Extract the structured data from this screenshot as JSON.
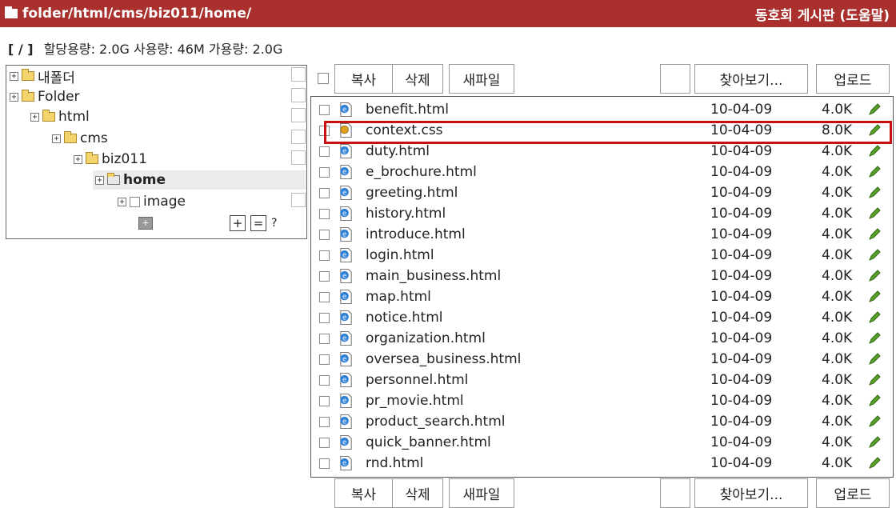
{
  "title": {
    "path": "folder/html/cms/biz011/home/",
    "right": "동호회 게시판 (도움말)"
  },
  "quota": {
    "root": "[ / ]",
    "text": "할당용량: 2.0G   사용량: 46M   가용량: 2.0G"
  },
  "tree": {
    "items": [
      {
        "label": "내폴더"
      },
      {
        "label": "Folder"
      },
      {
        "label": "html"
      },
      {
        "label": "cms"
      },
      {
        "label": "biz011"
      },
      {
        "label": "home"
      },
      {
        "label": "image"
      }
    ],
    "buttons": {
      "add": "+",
      "equal": "=",
      "help": "?"
    }
  },
  "toolbar": {
    "copy": "복사",
    "delete": "삭제",
    "newfile": "새파일",
    "browse": "찾아보기...",
    "upload": "업로드"
  },
  "files": [
    {
      "name": "benefit.html",
      "date": "10-04-09",
      "size": "4.0K",
      "type": "html-file-icon"
    },
    {
      "name": "context.css",
      "date": "10-04-09",
      "size": "8.0K",
      "type": "css-file-icon"
    },
    {
      "name": "duty.html",
      "date": "10-04-09",
      "size": "4.0K",
      "type": "html-file-icon"
    },
    {
      "name": "e_brochure.html",
      "date": "10-04-09",
      "size": "4.0K",
      "type": "html-file-icon"
    },
    {
      "name": "greeting.html",
      "date": "10-04-09",
      "size": "4.0K",
      "type": "html-file-icon"
    },
    {
      "name": "history.html",
      "date": "10-04-09",
      "size": "4.0K",
      "type": "html-file-icon"
    },
    {
      "name": "introduce.html",
      "date": "10-04-09",
      "size": "4.0K",
      "type": "html-file-icon"
    },
    {
      "name": "login.html",
      "date": "10-04-09",
      "size": "4.0K",
      "type": "html-file-icon"
    },
    {
      "name": "main_business.html",
      "date": "10-04-09",
      "size": "4.0K",
      "type": "html-file-icon"
    },
    {
      "name": "map.html",
      "date": "10-04-09",
      "size": "4.0K",
      "type": "html-file-icon"
    },
    {
      "name": "notice.html",
      "date": "10-04-09",
      "size": "4.0K",
      "type": "html-file-icon"
    },
    {
      "name": "organization.html",
      "date": "10-04-09",
      "size": "4.0K",
      "type": "html-file-icon"
    },
    {
      "name": "oversea_business.html",
      "date": "10-04-09",
      "size": "4.0K",
      "type": "html-file-icon"
    },
    {
      "name": "personnel.html",
      "date": "10-04-09",
      "size": "4.0K",
      "type": "html-file-icon"
    },
    {
      "name": "pr_movie.html",
      "date": "10-04-09",
      "size": "4.0K",
      "type": "html-file-icon"
    },
    {
      "name": "product_search.html",
      "date": "10-04-09",
      "size": "4.0K",
      "type": "html-file-icon"
    },
    {
      "name": "quick_banner.html",
      "date": "10-04-09",
      "size": "4.0K",
      "type": "html-file-icon"
    },
    {
      "name": "rnd.html",
      "date": "10-04-09",
      "size": "4.0K",
      "type": "html-file-icon"
    }
  ],
  "colors": {
    "titlebar": "#a9302c",
    "highlight": "#c81010",
    "edit": "#59a02a"
  }
}
